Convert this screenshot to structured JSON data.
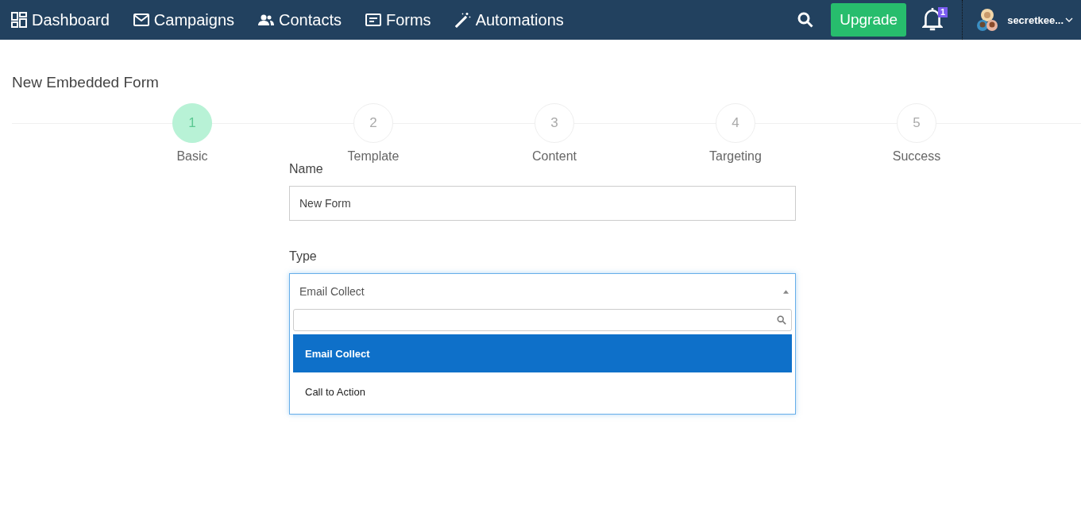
{
  "nav": {
    "items": [
      {
        "label": "Dashboard",
        "kind": "dashboard"
      },
      {
        "label": "Campaigns",
        "kind": "mail"
      },
      {
        "label": "Contacts",
        "kind": "people"
      },
      {
        "label": "Forms",
        "kind": "form"
      },
      {
        "label": "Automations",
        "kind": "wand"
      }
    ],
    "upgrade": "Upgrade",
    "notifications": "1",
    "user": "secretkee..."
  },
  "page_title": "New Embedded Form",
  "steps": [
    {
      "number": "1",
      "label": "Basic",
      "selected": true
    },
    {
      "number": "2",
      "label": "Template",
      "selected": false
    },
    {
      "number": "3",
      "label": "Content",
      "selected": false
    },
    {
      "number": "4",
      "label": "Targeting",
      "selected": false
    },
    {
      "number": "5",
      "label": "Success",
      "selected": false
    }
  ],
  "name_field": {
    "label": "Name",
    "value": "New Form"
  },
  "type_field": {
    "label": "Type",
    "value": "Email Collect",
    "expanded": true,
    "options": [
      {
        "label": "Email Collect",
        "selected": true
      },
      {
        "label": "Call to Action",
        "selected": false
      }
    ]
  }
}
